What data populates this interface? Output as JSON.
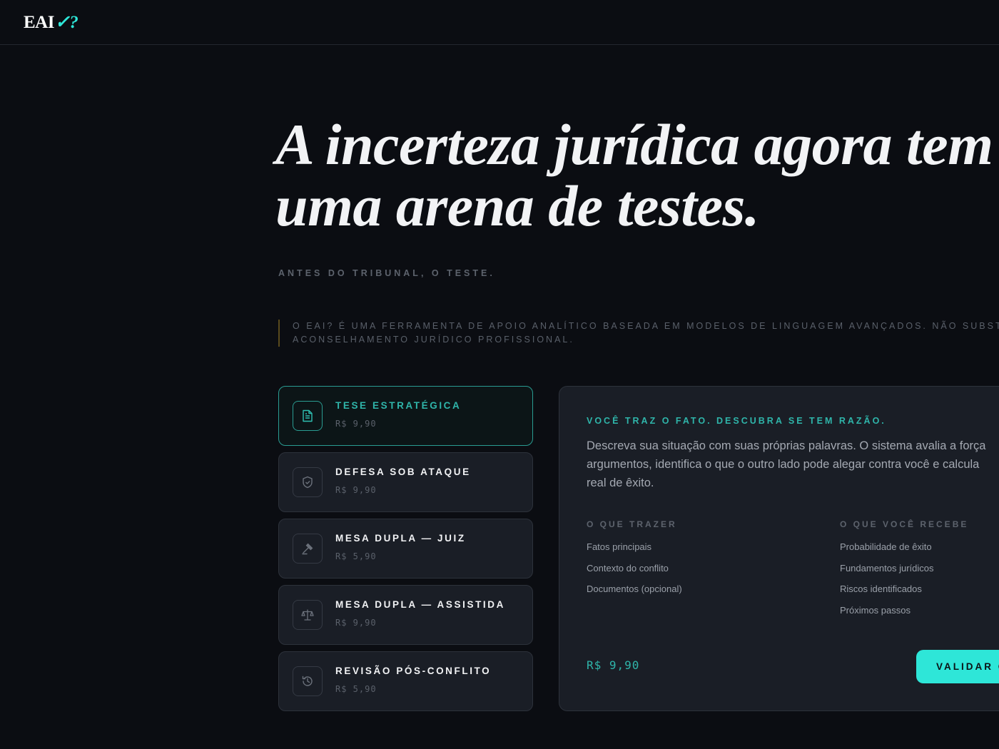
{
  "brand": {
    "logo_text": "EAI",
    "logo_mark": "✓?"
  },
  "hero": {
    "title_line1": "A incerteza jurídica agora tem",
    "title_line2": "uma arena de testes.",
    "kicker": "ANTES DO TRIBUNAL, O TESTE.",
    "disclaimer_line1": "O EAI? É UMA FERRAMENTA DE APOIO ANALÍTICO BASEADA EM MODELOS DE LINGUAGEM AVANÇADOS. NÃO SUBSTITUI",
    "disclaimer_line2": "ACONSELHAMENTO JURÍDICO PROFISSIONAL."
  },
  "services": [
    {
      "name": "TESE ESTRATÉGICA",
      "price": "R$ 9,90",
      "icon": "document-icon",
      "active": true
    },
    {
      "name": "DEFESA SOB ATAQUE",
      "price": "R$ 9,90",
      "icon": "shield-icon",
      "active": false
    },
    {
      "name": "MESA DUPLA — JUIZ",
      "price": "R$ 5,90",
      "icon": "gavel-icon",
      "active": false
    },
    {
      "name": "MESA DUPLA — ASSISTIDA",
      "price": "R$ 9,90",
      "icon": "scales-icon",
      "active": false
    },
    {
      "name": "REVISÃO PÓS-CONFLITO",
      "price": "R$ 5,90",
      "icon": "history-icon",
      "active": false
    }
  ],
  "panel": {
    "kicker": "VOCÊ TRAZ O FATO. DESCUBRA SE TEM RAZÃO.",
    "description_line1": "Descreva sua situação com suas próprias palavras. O sistema avalia a força",
    "description_line2": "argumentos, identifica o que o outro lado pode alegar contra você e calcula",
    "description_line3": "real de êxito.",
    "bring_heading": "O QUE TRAZER",
    "bring_items": [
      "Fatos principais",
      "Contexto do conflito",
      "Documentos (opcional)"
    ],
    "receive_heading": "O QUE VOCÊ RECEBE",
    "receive_items": [
      "Probabilidade de êxito",
      "Fundamentos jurídicos",
      "Riscos identificados",
      "Próximos passos"
    ],
    "price": "R$ 9,90",
    "button_label": "VALIDAR C"
  },
  "colors": {
    "accent": "#2ee6d8",
    "accent_text": "#2fb5aa",
    "background": "#0b0d12",
    "card": "#1a1e26"
  }
}
